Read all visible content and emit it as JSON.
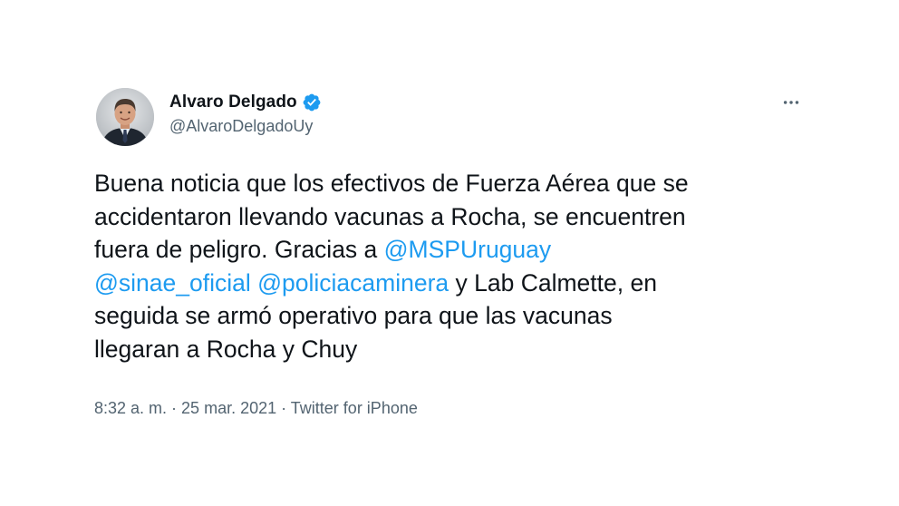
{
  "author": {
    "display_name": "Alvaro Delgado",
    "handle": "@AlvaroDelgadoUy",
    "verified": true,
    "verified_color": "#1d9bf0",
    "avatar_icon": "profile-photo"
  },
  "menu": {
    "icon": "more-horizontal-icon"
  },
  "tweet": {
    "lines": [
      [
        {
          "text": "Buena noticia que los efectivos de Fuerza Aérea que se",
          "type": "text"
        }
      ],
      [
        {
          "text": "accidentaron llevando vacunas a Rocha, se encuentren",
          "type": "text"
        }
      ],
      [
        {
          "text": "fuera de peligro. Gracias a ",
          "type": "text"
        },
        {
          "text": "@MSPUruguay",
          "type": "mention"
        }
      ],
      [
        {
          "text": "@sinae_oficial",
          "type": "mention"
        },
        {
          "text": " ",
          "type": "text"
        },
        {
          "text": "@policiacaminera",
          "type": "mention"
        },
        {
          "text": " y Lab Calmette, en",
          "type": "text"
        }
      ],
      [
        {
          "text": "seguida se armó operativo para que las vacunas",
          "type": "text"
        }
      ],
      [
        {
          "text": "llegaran a Rocha y Chuy",
          "type": "text"
        }
      ]
    ],
    "mention_color": "#1d9bf0"
  },
  "meta": {
    "time": "8:32 a. m.",
    "separator": " · ",
    "date": "25 mar. 2021",
    "source": "Twitter for iPhone"
  }
}
